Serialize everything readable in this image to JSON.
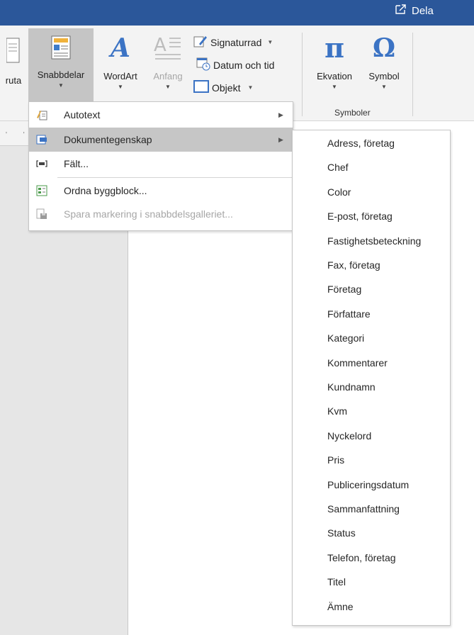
{
  "titlebar": {
    "share_label": "Dela",
    "accent": "#2b579a"
  },
  "ribbon": {
    "buttons": {
      "textbox_label": "ruta",
      "quickparts_label": "Snabbdelar",
      "wordart_label": "WordArt",
      "dropcap_label": "Anfang",
      "equation_label": "Ekvation",
      "symbol_label": "Symbol"
    },
    "small_buttons": {
      "signature_label": "Signaturrad",
      "datetime_label": "Datum och tid",
      "object_label": "Objekt"
    },
    "groups": {
      "symbols_label": "Symboler"
    }
  },
  "menu": {
    "items": [
      {
        "label": "Autotext",
        "icon": "autotext-icon",
        "has_submenu": true,
        "state": "normal"
      },
      {
        "label": "Dokumentegenskap",
        "icon": "document-property-icon",
        "has_submenu": true,
        "state": "hover"
      },
      {
        "label": "Fält...",
        "icon": "field-icon",
        "has_submenu": false,
        "state": "normal"
      },
      {
        "label": "Ordna byggblock...",
        "icon": "building-blocks-icon",
        "has_submenu": false,
        "state": "normal"
      },
      {
        "label": "Spara markering i snabbdelsgalleriet...",
        "icon": "save-to-gallery-icon",
        "has_submenu": false,
        "state": "disabled"
      }
    ]
  },
  "submenu": {
    "items": [
      "Adress, företag",
      "Chef",
      "Color",
      "E-post, företag",
      "Fastighetsbeteckning",
      "Fax, företag",
      "Företag",
      "Författare",
      "Kategori",
      "Kommentarer",
      "Kundnamn",
      "Kvm",
      "Nyckelord",
      "Pris",
      "Publiceringsdatum",
      "Sammanfattning",
      "Status",
      "Telefon, företag",
      "Titel",
      "Ämne"
    ]
  }
}
